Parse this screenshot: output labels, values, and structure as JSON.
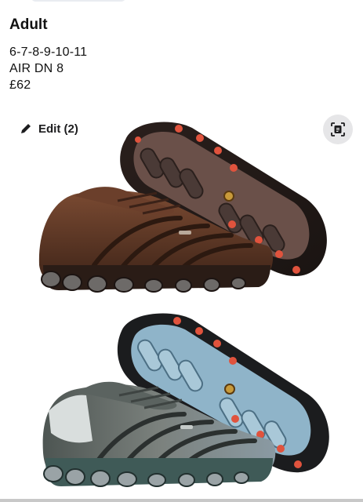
{
  "listing": {
    "heading": "Adult",
    "sizes": "6-7-8-9-10-11",
    "model": "AIR DN 8",
    "price": "£62"
  },
  "toolbar": {
    "edit_label": "Edit (2)",
    "edit_icon": "pencil-icon",
    "scan_icon": "live-text-icon"
  },
  "photos": [
    {
      "name": "shoe-photo-brown",
      "upper_color": "#5a3626",
      "sole_color": "#4a3a36",
      "accent_color": "#e0533d"
    },
    {
      "name": "shoe-photo-grey-blue",
      "upper_color": "#6c726f",
      "sole_color": "#8fb4c9",
      "accent_color": "#e0533d"
    }
  ]
}
